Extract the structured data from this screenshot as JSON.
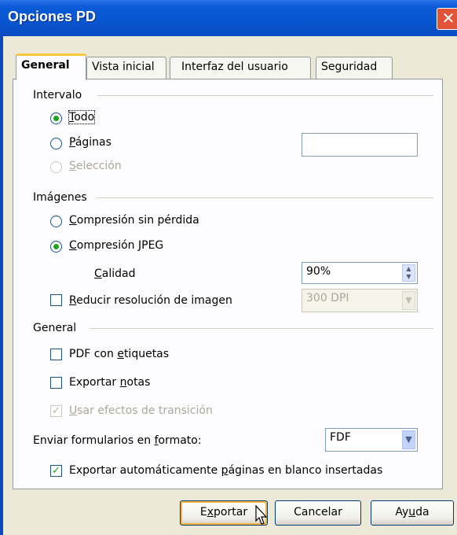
{
  "window": {
    "title": "Opciones PD",
    "close_glyph": "✕"
  },
  "tabs": [
    {
      "label": "General",
      "active": true
    },
    {
      "label": "Vista inicial",
      "active": false
    },
    {
      "label": "Interfaz del usuario",
      "active": false
    },
    {
      "label": "Seguridad",
      "active": false
    }
  ],
  "intervalo": {
    "title": "Intervalo",
    "todo": "Todo",
    "paginas": "Páginas",
    "paginas_value": "",
    "seleccion": "Selección",
    "selected": "Todo"
  },
  "imagenes": {
    "title": "Imágenes",
    "sin_perdida": "Compresión sin pérdida",
    "jpeg": "Compresión JPEG",
    "calidad_label": "Calidad",
    "calidad_value": "90%",
    "reducir_label": "Reducir resolución de imagen",
    "reducir_checked": false,
    "dpi_value": "300 DPI",
    "selected": "Compresión JPEG"
  },
  "general": {
    "title": "General",
    "pdf_etiquetas": "PDF con etiquetas",
    "pdf_etiquetas_checked": false,
    "exportar_notas": "Exportar notas",
    "exportar_notas_checked": false,
    "efectos": "Usar efectos de transición",
    "efectos_checked": true,
    "formato_label": "Enviar formularios en formato:",
    "formato_value": "FDF",
    "auto_blancas": "Exportar automáticamente páginas en blanco insertadas",
    "auto_blancas_checked": true
  },
  "buttons": {
    "exportar": "Exportar",
    "cancelar": "Cancelar",
    "ayuda": "Ayuda"
  },
  "colors": {
    "titlebar": "#0A5AD6",
    "radio_dot": "#21A121",
    "dialog_bg": "#ECE9D8"
  }
}
